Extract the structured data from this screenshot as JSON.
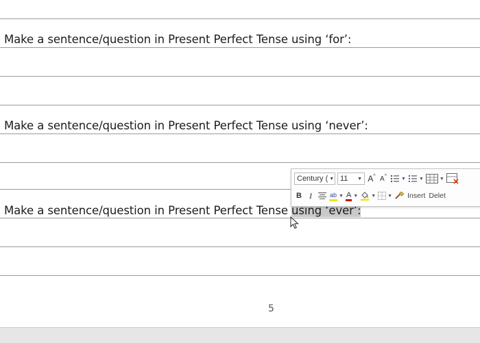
{
  "document": {
    "prompts": [
      "Make a sentence/question in Present Perfect Tense using ‘for’:",
      "Make a sentence/question in Present Perfect Tense using ‘never’:",
      "Make a sentence/question in Present Perfect Tense "
    ],
    "selected_text": "using ‘ever’:",
    "page_number": "5"
  },
  "mini_toolbar": {
    "font_name": "Century (",
    "font_size": "11",
    "grow_font_icon": "A",
    "shrink_font_icon": "A",
    "bold_label": "B",
    "italic_label": "I",
    "highlight_icon": "ab",
    "font_color_icon": "A",
    "insert_label": "Insert",
    "delete_label": "Delet",
    "highlight_color": "#f4e400",
    "font_color": "#d00000"
  }
}
